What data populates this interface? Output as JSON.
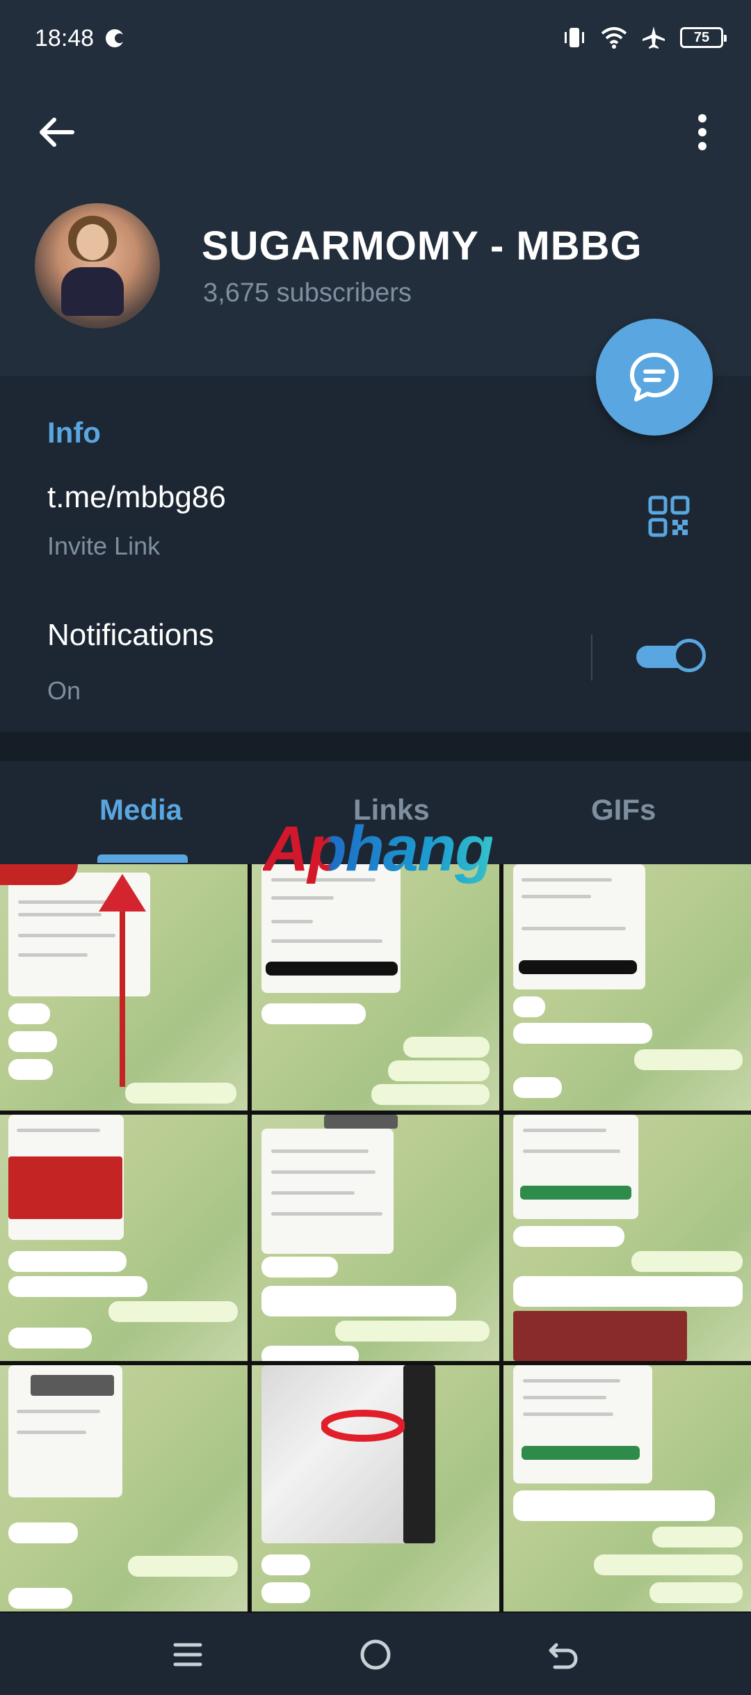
{
  "status_bar": {
    "time": "18:48",
    "battery": "75"
  },
  "header": {
    "title": "SUGARMOMY - MBBG",
    "subscribers": "3,675 subscribers"
  },
  "info": {
    "heading": "Info",
    "link": "t.me/mbbg86",
    "link_label": "Invite Link",
    "notifications_label": "Notifications",
    "notifications_state": "On",
    "notifications_enabled": true
  },
  "tabs": [
    {
      "label": "Media",
      "active": true
    },
    {
      "label": "Links",
      "active": false
    },
    {
      "label": "GIFs",
      "active": false
    }
  ],
  "watermark": "Aphang",
  "colors": {
    "accent": "#5aa6e0",
    "background": "#1d2733",
    "header": "#222e3b",
    "muted_text": "#7f8f9f"
  },
  "icons": {
    "back": "arrow-left-icon",
    "more": "more-vertical-icon",
    "fab": "message-icon",
    "qr": "qr-code-icon",
    "nav_menu": "menu-icon",
    "nav_home": "home-icon",
    "nav_back": "back-icon"
  }
}
